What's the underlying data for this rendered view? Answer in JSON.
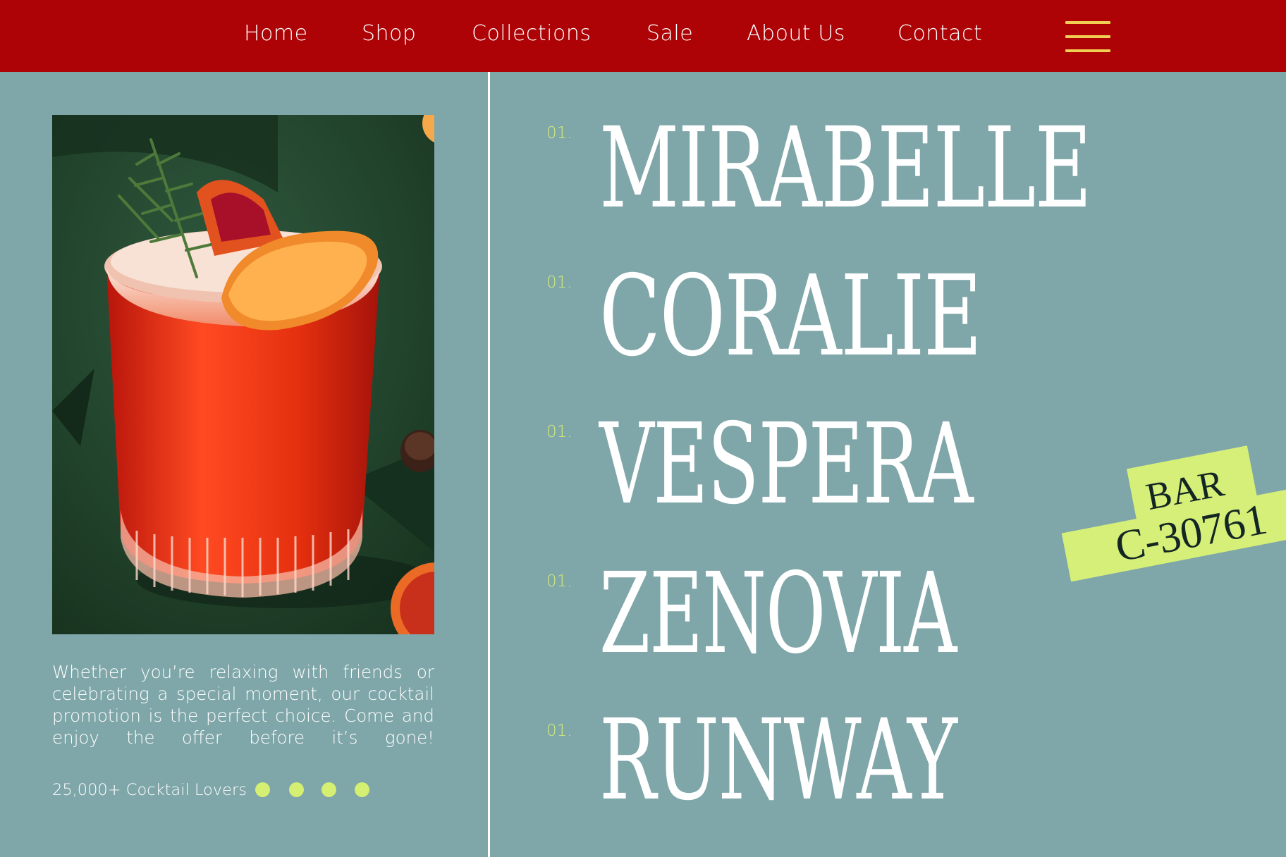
{
  "nav": {
    "items": [
      "Home",
      "Shop",
      "Collections",
      "Sale",
      "About Us",
      "Contact"
    ],
    "menu_icon": "hamburger-icon"
  },
  "hero": {
    "description": "Whether you’re relaxing with friends or celebrating a special moment, our cocktail promotion is the perfect choice. Come and enjoy the offer before it’s gone!",
    "lovers": "25,000+ Cocktail Lovers"
  },
  "list": [
    {
      "num": "01.",
      "name": "MIRABELLE"
    },
    {
      "num": "01.",
      "name": "CORALIE"
    },
    {
      "num": "01.",
      "name": "VESPERA"
    },
    {
      "num": "01.",
      "name": "ZENOVIA"
    },
    {
      "num": "01.",
      "name": "RUNWAY"
    }
  ],
  "stamp": {
    "line1": "BAR",
    "line2": "C-30761"
  },
  "colors": {
    "nav_bg": "#ad0306",
    "page_bg": "#7fa6a8",
    "accent_lime": "#d5ef72",
    "menu_icon": "#f0cf52"
  }
}
